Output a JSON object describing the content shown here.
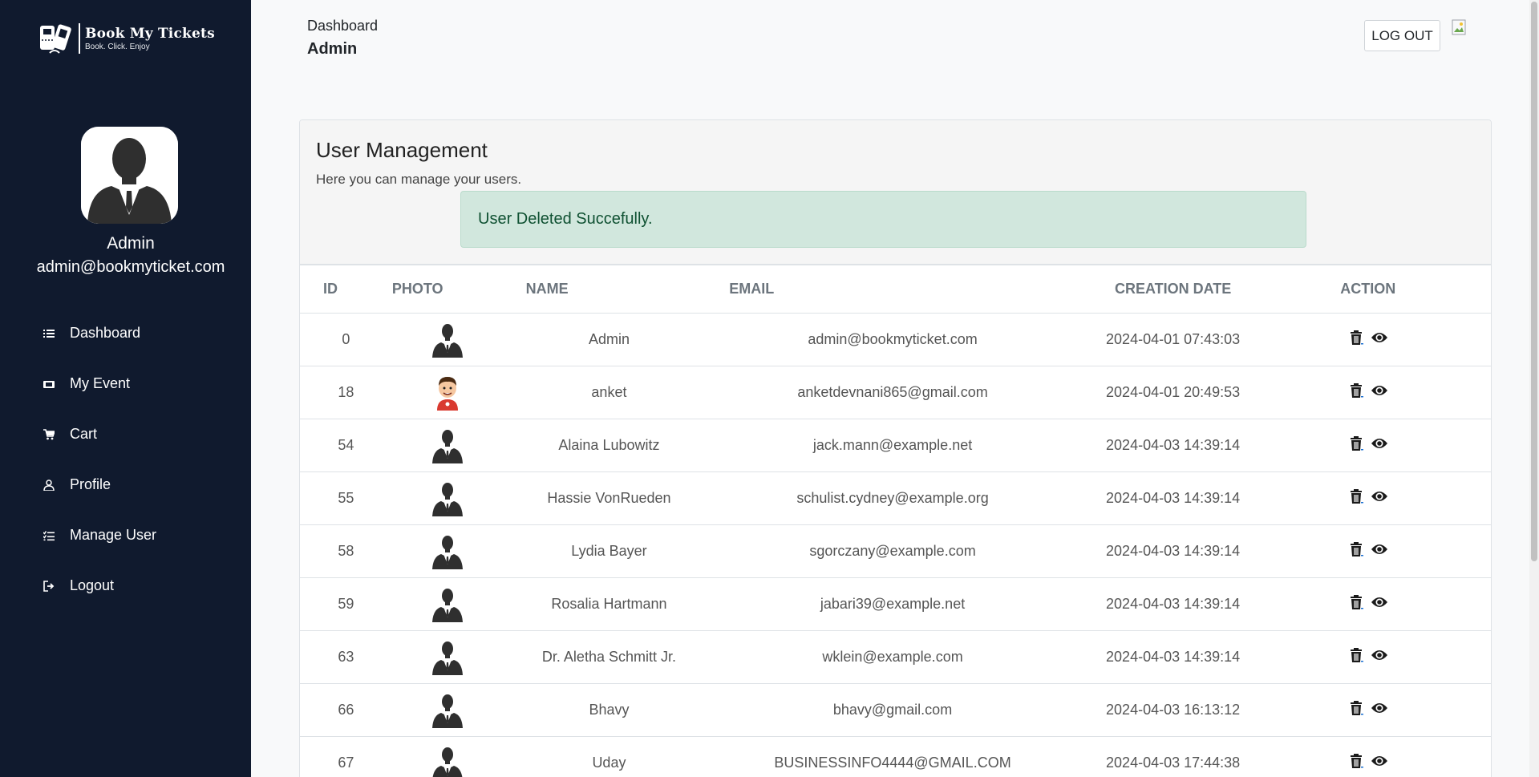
{
  "brand": {
    "title": "Book My Tickets",
    "tagline": "Book. Click. Enjoy"
  },
  "profile": {
    "name": "Admin",
    "email": "admin@bookmyticket.com"
  },
  "nav": [
    {
      "label": "Dashboard",
      "icon": "list-icon"
    },
    {
      "label": "My Event",
      "icon": "ticket-icon"
    },
    {
      "label": "Cart",
      "icon": "cart-icon"
    },
    {
      "label": "Profile",
      "icon": "user-icon"
    },
    {
      "label": "Manage User",
      "icon": "checklist-icon"
    },
    {
      "label": "Logout",
      "icon": "logout-icon"
    }
  ],
  "header": {
    "breadcrumb": "Dashboard",
    "title": "Admin",
    "logout_label": "LOG OUT"
  },
  "card": {
    "title": "User Management",
    "subtitle": "Here you can manage your users.",
    "alert": "User Deleted Succefully."
  },
  "table": {
    "headers": [
      "ID",
      "PHOTO",
      "NAME",
      "EMAIL",
      "CREATION DATE",
      "ACTION"
    ],
    "rows": [
      {
        "id": "0",
        "photo": "silhouette",
        "name": "Admin",
        "email": "admin@bookmyticket.com",
        "date": "2024-04-01 07:43:03"
      },
      {
        "id": "18",
        "photo": "cartoon",
        "name": "anket",
        "email": "anketdevnani865@gmail.com",
        "date": "2024-04-01 20:49:53"
      },
      {
        "id": "54",
        "photo": "silhouette",
        "name": "Alaina Lubowitz",
        "email": "jack.mann@example.net",
        "date": "2024-04-03 14:39:14"
      },
      {
        "id": "55",
        "photo": "silhouette",
        "name": "Hassie VonRueden",
        "email": "schulist.cydney@example.org",
        "date": "2024-04-03 14:39:14"
      },
      {
        "id": "58",
        "photo": "silhouette",
        "name": "Lydia Bayer",
        "email": "sgorczany@example.com",
        "date": "2024-04-03 14:39:14"
      },
      {
        "id": "59",
        "photo": "silhouette",
        "name": "Rosalia Hartmann",
        "email": "jabari39@example.net",
        "date": "2024-04-03 14:39:14"
      },
      {
        "id": "63",
        "photo": "silhouette",
        "name": "Dr. Aletha Schmitt Jr.",
        "email": "wklein@example.com",
        "date": "2024-04-03 14:39:14"
      },
      {
        "id": "66",
        "photo": "silhouette",
        "name": "Bhavy",
        "email": "bhavy@gmail.com",
        "date": "2024-04-03 16:13:12"
      },
      {
        "id": "67",
        "photo": "silhouette",
        "name": "Uday",
        "email": "BUSINESSINFO4444@GMAIL.COM",
        "date": "2024-04-03 17:44:38"
      }
    ]
  },
  "colors": {
    "sidebar": "#101a2e",
    "alert_bg": "#d1e7dd",
    "alert_text": "#0f5132"
  }
}
